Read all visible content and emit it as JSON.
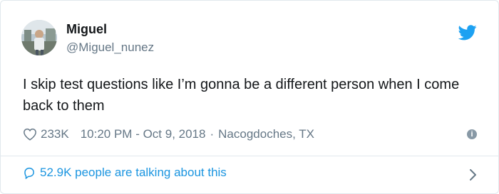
{
  "tweet": {
    "author_name": "Miguel",
    "author_handle": "@Miguel_nunez",
    "text": "I skip test questions like I’m gonna be a different person when I come back to them",
    "likes": "233K",
    "timestamp": "10:20 PM - Oct 9, 2018",
    "separator": "·",
    "location": "Nacogdoches, TX"
  },
  "footer": {
    "conversation_label": "52.9K people are talking about this"
  },
  "icons": {
    "brand": "twitter-bird-icon",
    "like": "heart-icon",
    "info": "info-icon",
    "conversation": "speech-bubble-icon",
    "more": "chevron-right-icon"
  },
  "colors": {
    "brand_blue": "#1da1f2",
    "link_blue": "#1b95e0",
    "secondary_text": "#657786",
    "primary_text": "#14171a",
    "border": "#e1e8ed"
  }
}
